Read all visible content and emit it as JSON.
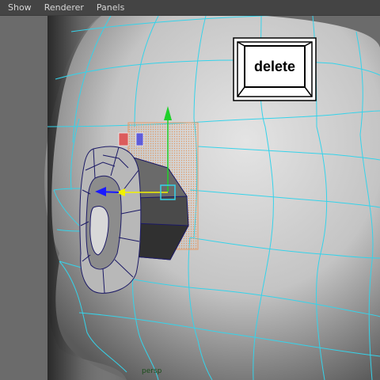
{
  "menubar": {
    "items": [
      {
        "label": "Show"
      },
      {
        "label": "Renderer"
      },
      {
        "label": "Panels"
      }
    ]
  },
  "overlay": {
    "key_label": "delete"
  },
  "viewport": {
    "camera_label": "persp"
  },
  "colors": {
    "wireframe": "#35d3ea",
    "selection_wire": "#1c1a66",
    "move_y_axis": "#1fd02a",
    "move_x_axis": "#f1f100",
    "move_z_axis": "#1a1aff",
    "face_highlight": "#e69a66",
    "menubar_bg": "#444444"
  },
  "icons": {
    "key": "keyboard-key-icon",
    "manip": "move-manipulator-icon"
  }
}
